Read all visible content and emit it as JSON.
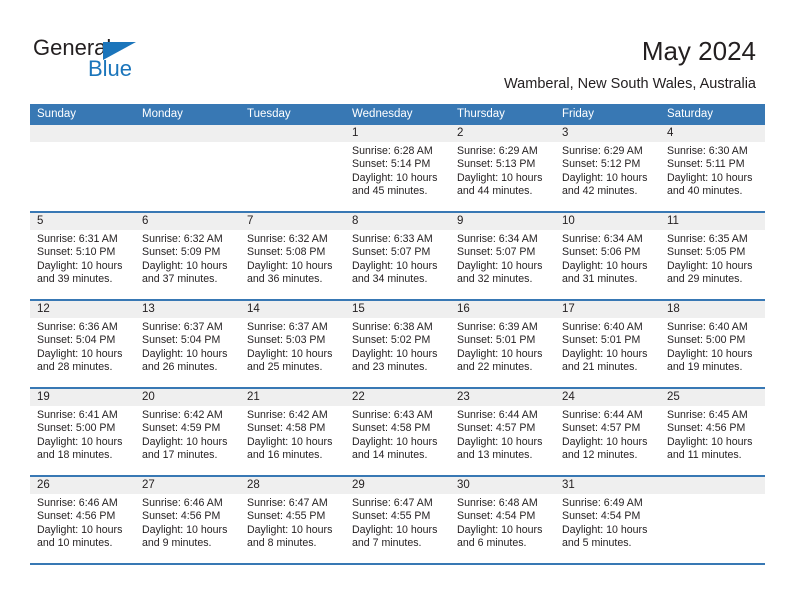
{
  "logo": {
    "word_one": "General",
    "word_two": "Blue",
    "accent_color": "#1b75bb"
  },
  "header": {
    "title": "May 2024",
    "subtitle": "Wamberal, New South Wales, Australia"
  },
  "calendar": {
    "header_color": "#3878b4",
    "daynum_band_color": "#efefef",
    "weekdays": [
      "Sunday",
      "Monday",
      "Tuesday",
      "Wednesday",
      "Thursday",
      "Friday",
      "Saturday"
    ],
    "weeks": [
      [
        {
          "day": "",
          "empty": true,
          "sunrise": "",
          "sunset": "",
          "daylight_line1": "",
          "daylight_line2": ""
        },
        {
          "day": "",
          "empty": true,
          "sunrise": "",
          "sunset": "",
          "daylight_line1": "",
          "daylight_line2": ""
        },
        {
          "day": "",
          "empty": true,
          "sunrise": "",
          "sunset": "",
          "daylight_line1": "",
          "daylight_line2": ""
        },
        {
          "day": "1",
          "empty": false,
          "sunrise": "Sunrise: 6:28 AM",
          "sunset": "Sunset: 5:14 PM",
          "daylight_line1": "Daylight: 10 hours",
          "daylight_line2": "and 45 minutes."
        },
        {
          "day": "2",
          "empty": false,
          "sunrise": "Sunrise: 6:29 AM",
          "sunset": "Sunset: 5:13 PM",
          "daylight_line1": "Daylight: 10 hours",
          "daylight_line2": "and 44 minutes."
        },
        {
          "day": "3",
          "empty": false,
          "sunrise": "Sunrise: 6:29 AM",
          "sunset": "Sunset: 5:12 PM",
          "daylight_line1": "Daylight: 10 hours",
          "daylight_line2": "and 42 minutes."
        },
        {
          "day": "4",
          "empty": false,
          "sunrise": "Sunrise: 6:30 AM",
          "sunset": "Sunset: 5:11 PM",
          "daylight_line1": "Daylight: 10 hours",
          "daylight_line2": "and 40 minutes."
        }
      ],
      [
        {
          "day": "5",
          "empty": false,
          "sunrise": "Sunrise: 6:31 AM",
          "sunset": "Sunset: 5:10 PM",
          "daylight_line1": "Daylight: 10 hours",
          "daylight_line2": "and 39 minutes."
        },
        {
          "day": "6",
          "empty": false,
          "sunrise": "Sunrise: 6:32 AM",
          "sunset": "Sunset: 5:09 PM",
          "daylight_line1": "Daylight: 10 hours",
          "daylight_line2": "and 37 minutes."
        },
        {
          "day": "7",
          "empty": false,
          "sunrise": "Sunrise: 6:32 AM",
          "sunset": "Sunset: 5:08 PM",
          "daylight_line1": "Daylight: 10 hours",
          "daylight_line2": "and 36 minutes."
        },
        {
          "day": "8",
          "empty": false,
          "sunrise": "Sunrise: 6:33 AM",
          "sunset": "Sunset: 5:07 PM",
          "daylight_line1": "Daylight: 10 hours",
          "daylight_line2": "and 34 minutes."
        },
        {
          "day": "9",
          "empty": false,
          "sunrise": "Sunrise: 6:34 AM",
          "sunset": "Sunset: 5:07 PM",
          "daylight_line1": "Daylight: 10 hours",
          "daylight_line2": "and 32 minutes."
        },
        {
          "day": "10",
          "empty": false,
          "sunrise": "Sunrise: 6:34 AM",
          "sunset": "Sunset: 5:06 PM",
          "daylight_line1": "Daylight: 10 hours",
          "daylight_line2": "and 31 minutes."
        },
        {
          "day": "11",
          "empty": false,
          "sunrise": "Sunrise: 6:35 AM",
          "sunset": "Sunset: 5:05 PM",
          "daylight_line1": "Daylight: 10 hours",
          "daylight_line2": "and 29 minutes."
        }
      ],
      [
        {
          "day": "12",
          "empty": false,
          "sunrise": "Sunrise: 6:36 AM",
          "sunset": "Sunset: 5:04 PM",
          "daylight_line1": "Daylight: 10 hours",
          "daylight_line2": "and 28 minutes."
        },
        {
          "day": "13",
          "empty": false,
          "sunrise": "Sunrise: 6:37 AM",
          "sunset": "Sunset: 5:04 PM",
          "daylight_line1": "Daylight: 10 hours",
          "daylight_line2": "and 26 minutes."
        },
        {
          "day": "14",
          "empty": false,
          "sunrise": "Sunrise: 6:37 AM",
          "sunset": "Sunset: 5:03 PM",
          "daylight_line1": "Daylight: 10 hours",
          "daylight_line2": "and 25 minutes."
        },
        {
          "day": "15",
          "empty": false,
          "sunrise": "Sunrise: 6:38 AM",
          "sunset": "Sunset: 5:02 PM",
          "daylight_line1": "Daylight: 10 hours",
          "daylight_line2": "and 23 minutes."
        },
        {
          "day": "16",
          "empty": false,
          "sunrise": "Sunrise: 6:39 AM",
          "sunset": "Sunset: 5:01 PM",
          "daylight_line1": "Daylight: 10 hours",
          "daylight_line2": "and 22 minutes."
        },
        {
          "day": "17",
          "empty": false,
          "sunrise": "Sunrise: 6:40 AM",
          "sunset": "Sunset: 5:01 PM",
          "daylight_line1": "Daylight: 10 hours",
          "daylight_line2": "and 21 minutes."
        },
        {
          "day": "18",
          "empty": false,
          "sunrise": "Sunrise: 6:40 AM",
          "sunset": "Sunset: 5:00 PM",
          "daylight_line1": "Daylight: 10 hours",
          "daylight_line2": "and 19 minutes."
        }
      ],
      [
        {
          "day": "19",
          "empty": false,
          "sunrise": "Sunrise: 6:41 AM",
          "sunset": "Sunset: 5:00 PM",
          "daylight_line1": "Daylight: 10 hours",
          "daylight_line2": "and 18 minutes."
        },
        {
          "day": "20",
          "empty": false,
          "sunrise": "Sunrise: 6:42 AM",
          "sunset": "Sunset: 4:59 PM",
          "daylight_line1": "Daylight: 10 hours",
          "daylight_line2": "and 17 minutes."
        },
        {
          "day": "21",
          "empty": false,
          "sunrise": "Sunrise: 6:42 AM",
          "sunset": "Sunset: 4:58 PM",
          "daylight_line1": "Daylight: 10 hours",
          "daylight_line2": "and 16 minutes."
        },
        {
          "day": "22",
          "empty": false,
          "sunrise": "Sunrise: 6:43 AM",
          "sunset": "Sunset: 4:58 PM",
          "daylight_line1": "Daylight: 10 hours",
          "daylight_line2": "and 14 minutes."
        },
        {
          "day": "23",
          "empty": false,
          "sunrise": "Sunrise: 6:44 AM",
          "sunset": "Sunset: 4:57 PM",
          "daylight_line1": "Daylight: 10 hours",
          "daylight_line2": "and 13 minutes."
        },
        {
          "day": "24",
          "empty": false,
          "sunrise": "Sunrise: 6:44 AM",
          "sunset": "Sunset: 4:57 PM",
          "daylight_line1": "Daylight: 10 hours",
          "daylight_line2": "and 12 minutes."
        },
        {
          "day": "25",
          "empty": false,
          "sunrise": "Sunrise: 6:45 AM",
          "sunset": "Sunset: 4:56 PM",
          "daylight_line1": "Daylight: 10 hours",
          "daylight_line2": "and 11 minutes."
        }
      ],
      [
        {
          "day": "26",
          "empty": false,
          "sunrise": "Sunrise: 6:46 AM",
          "sunset": "Sunset: 4:56 PM",
          "daylight_line1": "Daylight: 10 hours",
          "daylight_line2": "and 10 minutes."
        },
        {
          "day": "27",
          "empty": false,
          "sunrise": "Sunrise: 6:46 AM",
          "sunset": "Sunset: 4:56 PM",
          "daylight_line1": "Daylight: 10 hours",
          "daylight_line2": "and 9 minutes."
        },
        {
          "day": "28",
          "empty": false,
          "sunrise": "Sunrise: 6:47 AM",
          "sunset": "Sunset: 4:55 PM",
          "daylight_line1": "Daylight: 10 hours",
          "daylight_line2": "and 8 minutes."
        },
        {
          "day": "29",
          "empty": false,
          "sunrise": "Sunrise: 6:47 AM",
          "sunset": "Sunset: 4:55 PM",
          "daylight_line1": "Daylight: 10 hours",
          "daylight_line2": "and 7 minutes."
        },
        {
          "day": "30",
          "empty": false,
          "sunrise": "Sunrise: 6:48 AM",
          "sunset": "Sunset: 4:54 PM",
          "daylight_line1": "Daylight: 10 hours",
          "daylight_line2": "and 6 minutes."
        },
        {
          "day": "31",
          "empty": false,
          "sunrise": "Sunrise: 6:49 AM",
          "sunset": "Sunset: 4:54 PM",
          "daylight_line1": "Daylight: 10 hours",
          "daylight_line2": "and 5 minutes."
        },
        {
          "day": "",
          "empty": true,
          "sunrise": "",
          "sunset": "",
          "daylight_line1": "",
          "daylight_line2": ""
        }
      ]
    ]
  }
}
